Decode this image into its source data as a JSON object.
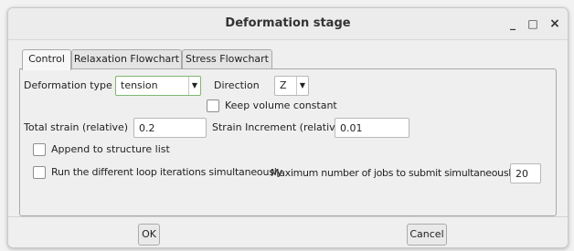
{
  "window": {
    "title": "Deformation stage",
    "minimize_glyph": "_",
    "maximize_glyph": "□",
    "close_glyph": "×"
  },
  "tabs": [
    {
      "label": "Control",
      "active": true
    },
    {
      "label": "Relaxation Flowchart",
      "active": false
    },
    {
      "label": "Stress Flowchart",
      "active": false
    }
  ],
  "control": {
    "deformation_type_label": "Deformation type",
    "deformation_type_value": "tension",
    "direction_label": "Direction",
    "direction_value": "Z",
    "keep_volume_label": "Keep volume constant",
    "keep_volume_checked": false,
    "total_strain_label": "Total strain (relative)",
    "total_strain_value": "0.2",
    "strain_increment_label": "Strain Increment (relative)",
    "strain_increment_value": "0.01",
    "append_label": "Append to structure list",
    "append_checked": false,
    "run_loop_label": "Run the different loop iterations simultaneously",
    "run_loop_checked": false,
    "max_jobs_label": "Maximum number of jobs to submit simultaneously",
    "max_jobs_value": "20"
  },
  "footer": {
    "ok_label": "OK",
    "cancel_label": "Cancel"
  },
  "icons": {
    "dropdown": "chevron-down-icon",
    "minimize": "minimize-icon",
    "maximize": "maximize-icon",
    "close": "close-icon"
  }
}
